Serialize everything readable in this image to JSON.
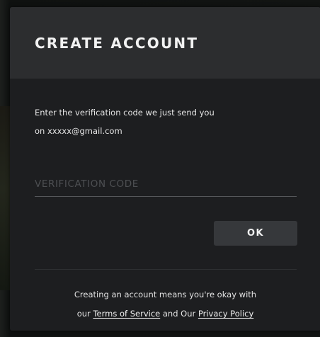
{
  "dialog": {
    "title": "CREATE ACCOUNT",
    "instruction_line1": "Enter the verification code we just send you",
    "instruction_line2": "on xxxxx@gmail.com",
    "code_input": {
      "placeholder": "VERIFICATION CODE",
      "value": ""
    },
    "ok_label": "OK",
    "terms": {
      "line1": "Creating an account means you're okay with",
      "prefix": "our",
      "terms_link": "Terms of Service",
      "middle": "and Our",
      "privacy_link": "Privacy Policy"
    }
  },
  "colors": {
    "dialog_background": "#1d1e20",
    "header_background": "#2c2d2f",
    "button_background": "#36383b",
    "text": "#e6e6e6"
  }
}
